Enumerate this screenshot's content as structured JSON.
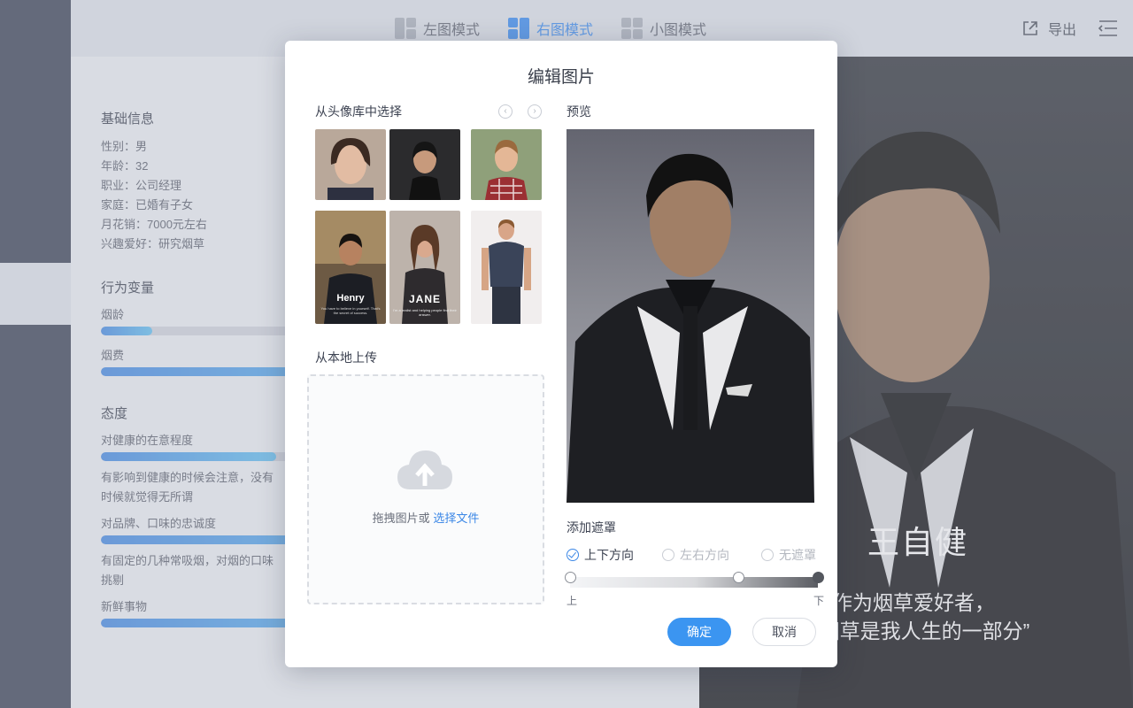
{
  "topbar": {
    "modes": [
      {
        "label": "左图模式",
        "active": false
      },
      {
        "label": "右图模式",
        "active": true
      },
      {
        "label": "小图模式",
        "active": false
      }
    ],
    "export_label": "导出"
  },
  "profile": {
    "basic_title": "基础信息",
    "basic_lines": [
      "性别：男",
      "年龄：32",
      "职业：公司经理",
      "家庭：已婚有子女",
      "月花销：7000元左右",
      "兴趣爱好：研究烟草"
    ],
    "behavior_title": "行为变量",
    "behavior_items": [
      {
        "label": "烟龄",
        "value": 0.09
      },
      {
        "label": "烟费",
        "value": 0.62
      }
    ],
    "attitude_title": "态度",
    "attitude_items": [
      {
        "label": "对健康的在意程度",
        "value": 0.31,
        "note_lines": [
          "有影响到健康的时候会注意，没有",
          "时候就觉得无所谓"
        ]
      },
      {
        "label": "对品牌、口味的忠诚度",
        "value": 0.64,
        "note_lines": [
          "有固定的几种常吸烟，对烟的口味",
          "挑剔"
        ]
      },
      {
        "label": "新鲜事物",
        "value": 0.58,
        "note_lines": []
      }
    ]
  },
  "panel": {
    "name": "王自健",
    "quote_lines": [
      "作为烟草爱好者，",
      "“烟草是我人生的一部分”"
    ]
  },
  "modal": {
    "title": "编辑图片",
    "library_label": "从头像库中选择",
    "preview_label": "预览",
    "prev_glyph": "‹",
    "next_glyph": "›",
    "thumb_captions": {
      "henry": "Henry",
      "henry_sub": "You have to believe in yourself. That's the secret of success.",
      "jane": "JANE",
      "jane_sub": "I'm a realist and helping people find their answer."
    },
    "upload_label": "从本地上传",
    "drop_text": "拖拽图片或",
    "choose_file": "选择文件",
    "mask_label": "添加遮罩",
    "mask_options": [
      {
        "label": "上下方向",
        "checked": true
      },
      {
        "label": "左右方向",
        "checked": false
      },
      {
        "label": "无遮罩",
        "checked": false
      }
    ],
    "mask_slider": {
      "min_label": "上",
      "max_label": "下",
      "value": 0.68
    },
    "confirm": "确定",
    "cancel": "取消"
  },
  "colors": {
    "accent": "#3b87e6",
    "primary_button": "#3b95f1",
    "rail": "#3d4558"
  }
}
